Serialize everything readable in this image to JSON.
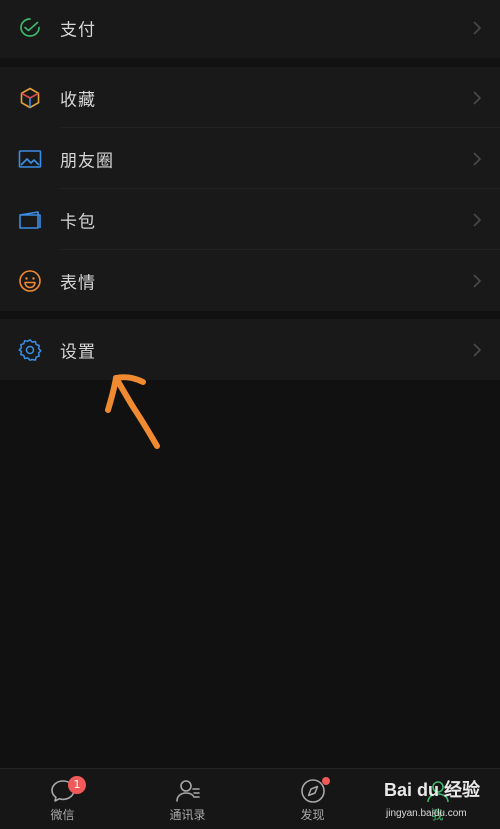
{
  "menu": {
    "pay": {
      "label": "支付",
      "icon": "pay-check-icon"
    },
    "favorites": {
      "label": "收藏",
      "icon": "cube-icon"
    },
    "moments": {
      "label": "朋友圈",
      "icon": "picture-icon"
    },
    "cards": {
      "label": "卡包",
      "icon": "wallet-icon"
    },
    "stickers": {
      "label": "表情",
      "icon": "smiley-icon"
    },
    "settings": {
      "label": "设置",
      "icon": "gear-icon"
    }
  },
  "tabbar": {
    "chats": {
      "label": "微信",
      "badge": "1"
    },
    "contacts": {
      "label": "通讯录"
    },
    "discover": {
      "label": "发现"
    },
    "me": {
      "label": "我"
    }
  },
  "watermark": {
    "brand": "Bai du 经验",
    "url": "jingyan.baidu.com"
  },
  "colors": {
    "background": "#111111",
    "cell": "#191919",
    "accent_orange": "#f08a30",
    "badge": "#f25a5a"
  }
}
